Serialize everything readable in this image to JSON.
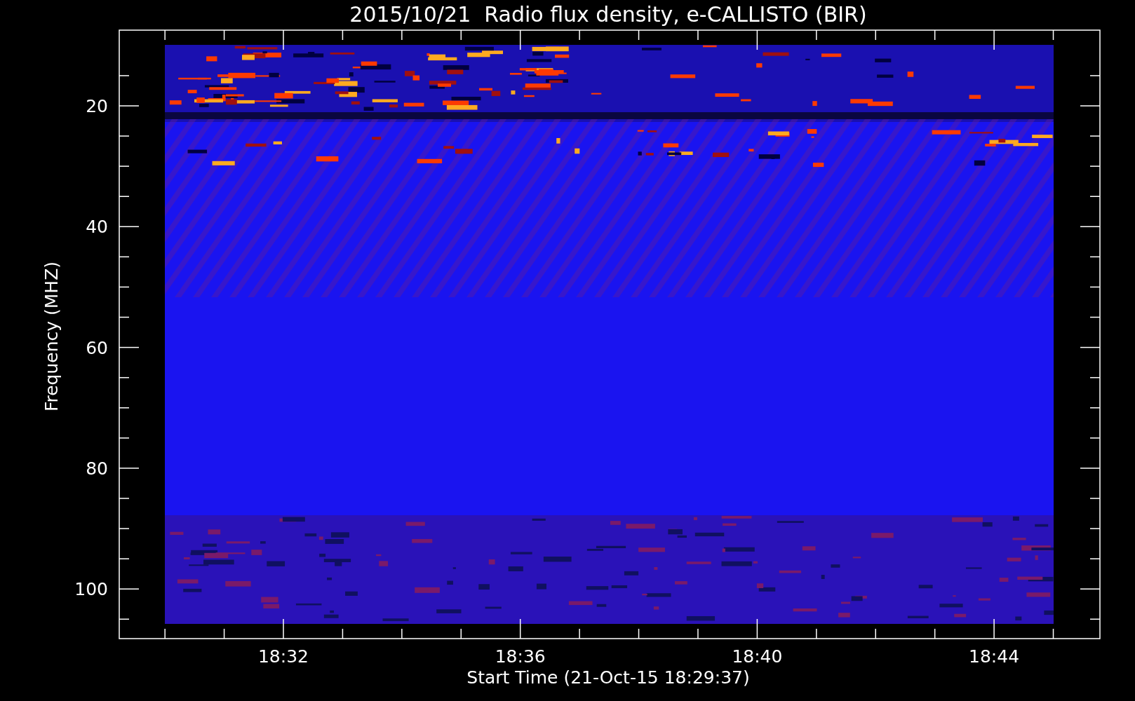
{
  "title": "2015/10/21  Radio flux density, e-CALLISTO (BIR)",
  "y_axis": {
    "label": "Frequency (MHZ)",
    "ticks": [
      "20",
      "40",
      "60",
      "80",
      "100"
    ]
  },
  "x_axis": {
    "label": "Start Time (21-Oct-15 18:29:37)",
    "ticks": [
      "18:32",
      "18:36",
      "18:40",
      "18:44"
    ]
  }
}
